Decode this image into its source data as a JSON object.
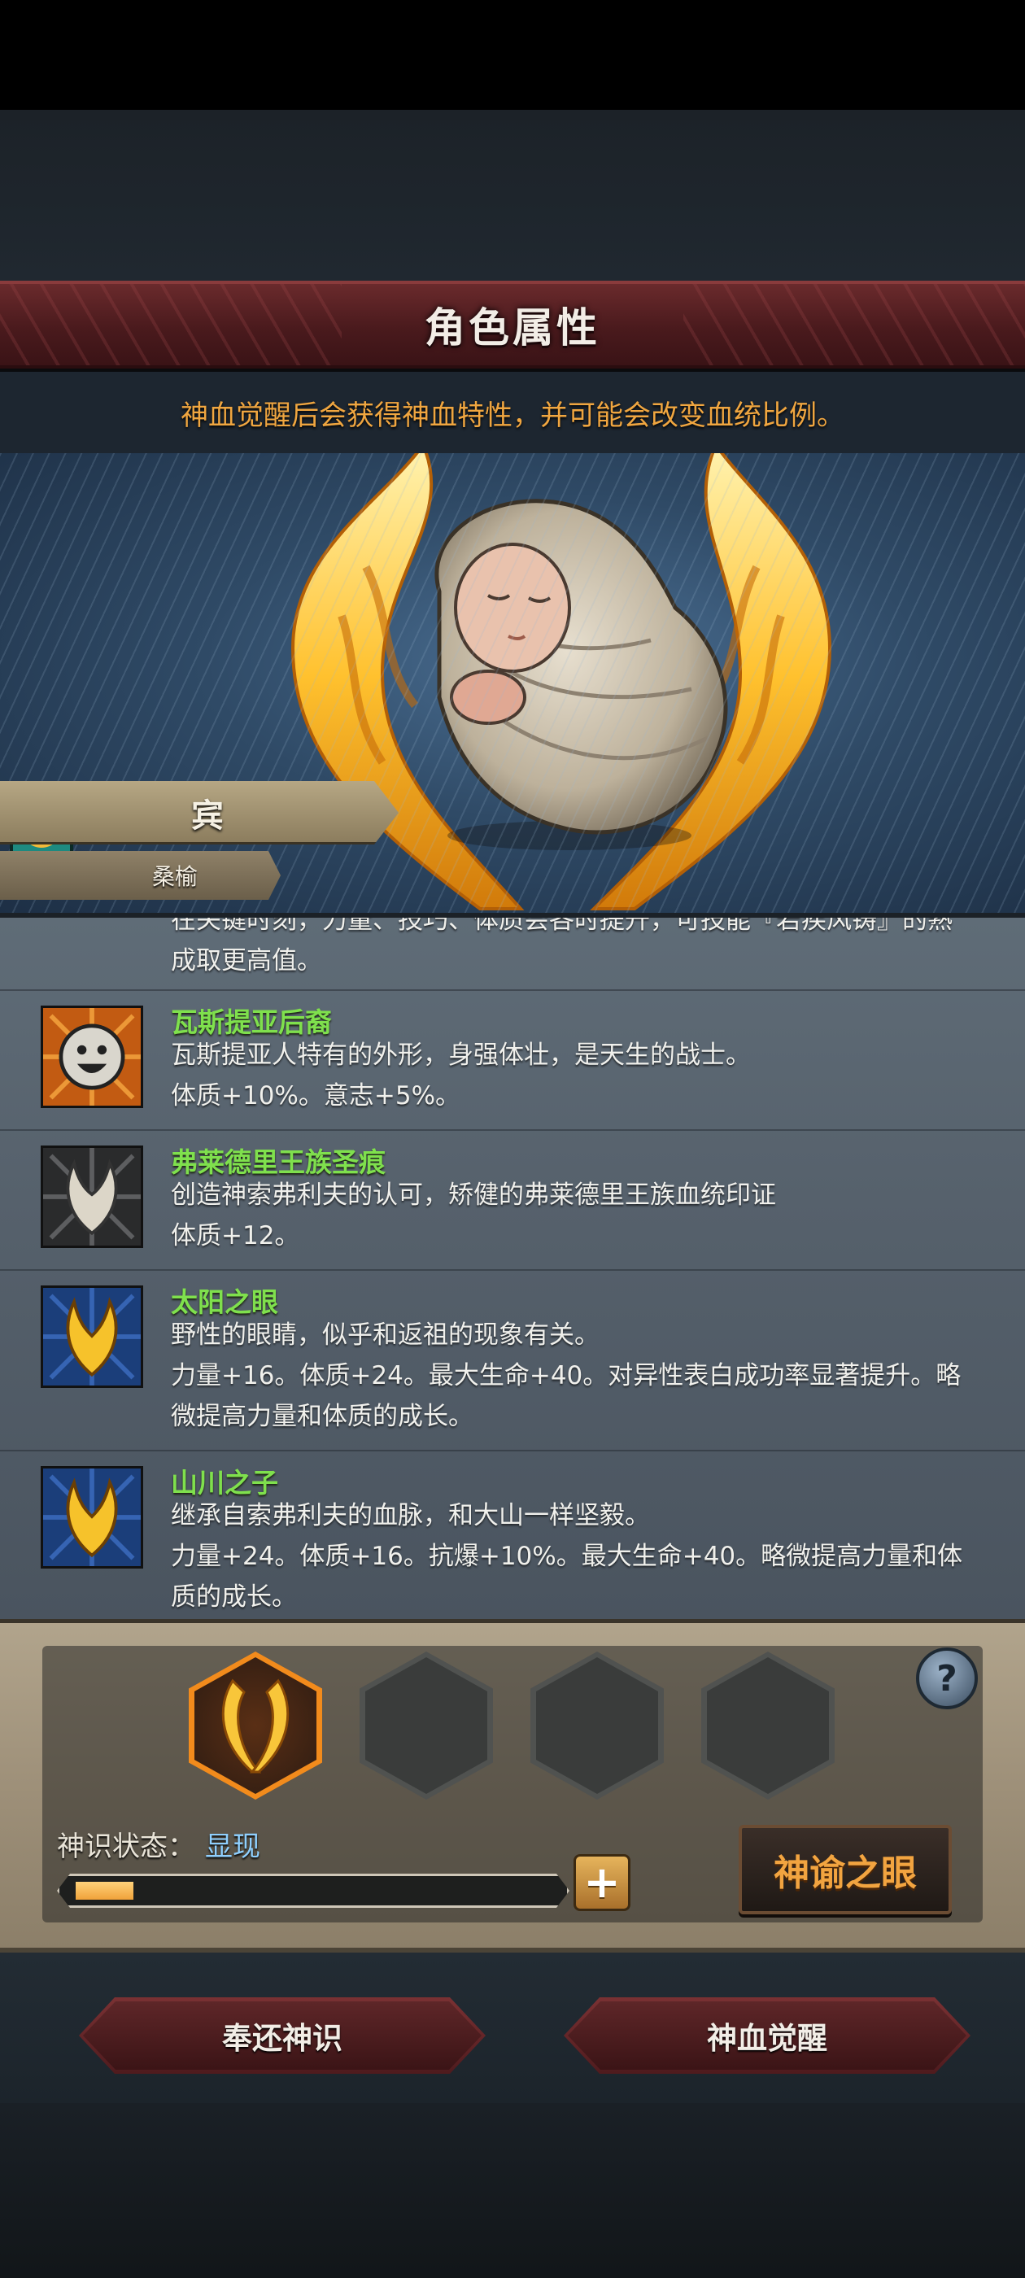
{
  "header": {
    "title": "角色属性",
    "subtitle": "神血觉醒后会获得神血特性，并可能会改变血统比例。"
  },
  "character": {
    "name": "宾",
    "class": "桑榆"
  },
  "traits": {
    "partial_top": {
      "line1": "在关键时刻，力量、技巧、体质会各时提升，可技能『若疾风铸』的熟",
      "line2": "成取更高值。"
    },
    "items": [
      {
        "name": "瓦斯提亚后裔",
        "icon": "smiling-face-icon",
        "line1": "瓦斯提亚人特有的外形，身强体壮，是天生的战士。",
        "line2": "体质+10%。意志+5%。"
      },
      {
        "name": "弗莱德里王族圣痕",
        "icon": "silver-wings-crest-icon",
        "line1": "创造神索弗利夫的认可，矫健的弗莱德里王族血统印证",
        "line2": "体质+12。"
      },
      {
        "name": "太阳之眼",
        "icon": "golden-flame-crest-icon",
        "line1": "野性的眼睛，似乎和返祖的现象有关。",
        "line2": "力量+16。体质+24。最大生命+40。对异性表白成功率显著提升。略",
        "line3": "微提高力量和体质的成长。"
      },
      {
        "name": "山川之子",
        "icon": "golden-flame-crest-icon",
        "line1": "继承自索弗利夫的血脉，和大山一样坚毅。",
        "line2": "力量+24。体质+16。抗爆+10%。最大生命+40。略微提高力量和体",
        "line3": "质的成长。"
      }
    ]
  },
  "divine": {
    "status_label": "神识状态：",
    "status_value": "显现",
    "progress": 0.12,
    "plus_label": "+",
    "oracle_button": "神谕之眼",
    "help_label": "?",
    "slots": [
      "golden-wings-icon",
      "empty",
      "empty",
      "empty"
    ]
  },
  "footer": {
    "return_button": "奉还神识",
    "awaken_button": "神血觉醒"
  },
  "colors": {
    "trait_name": "#7fe04d",
    "subtitle": "#f0a640",
    "status_value": "#8fd0ff",
    "oracle_text": "#f2a440",
    "active_slot": "#f28b1c"
  }
}
